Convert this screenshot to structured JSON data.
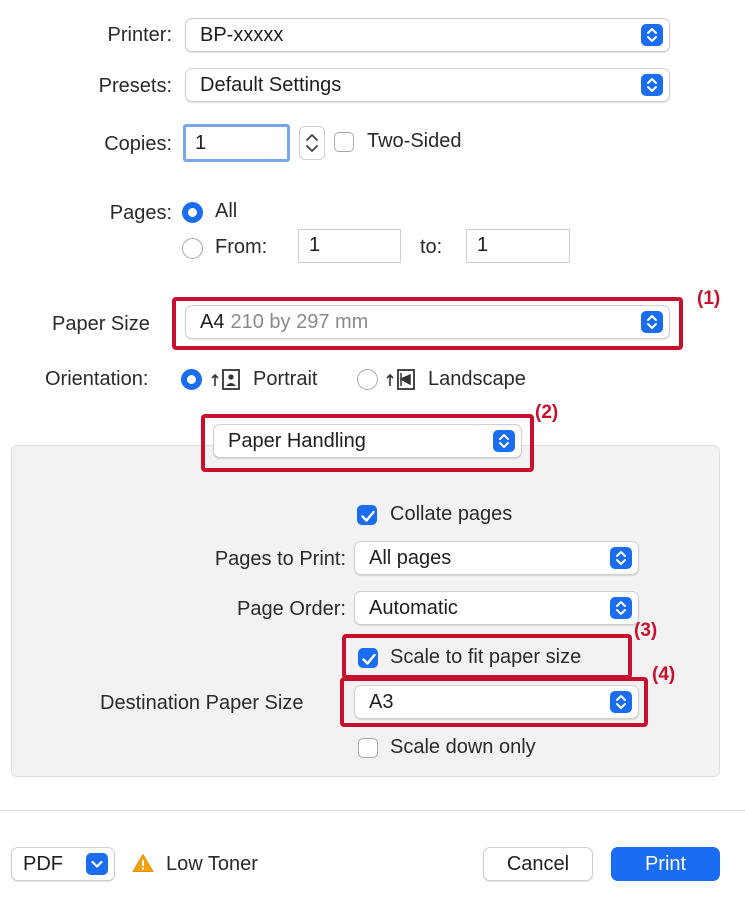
{
  "printer": {
    "label": "Printer:",
    "value": "BP-xxxxx"
  },
  "presets": {
    "label": "Presets:",
    "value": "Default Settings"
  },
  "copies": {
    "label": "Copies:",
    "value": "1",
    "two_sided_label": "Two-Sided",
    "two_sided_checked": false
  },
  "pages": {
    "label": "Pages:",
    "all_label": "All",
    "from_label": "From:",
    "from_value": "1",
    "to_label": "to:",
    "to_value": "1",
    "selected": "All"
  },
  "paper_size": {
    "label": "Paper Size",
    "value": "A4",
    "detail": "210 by 297 mm"
  },
  "orientation": {
    "label": "Orientation:",
    "portrait_label": "Portrait",
    "landscape_label": "Landscape",
    "selected": "Portrait"
  },
  "section_menu": {
    "value": "Paper Handling"
  },
  "paper_handling": {
    "collate_label": "Collate pages",
    "collate_checked": true,
    "pages_to_print_label": "Pages to Print:",
    "pages_to_print_value": "All pages",
    "page_order_label": "Page Order:",
    "page_order_value": "Automatic",
    "scale_fit_label": "Scale to fit paper size",
    "scale_fit_checked": true,
    "dest_size_label": "Destination Paper Size",
    "dest_size_value": "A3",
    "scale_down_label": "Scale down only",
    "scale_down_checked": false
  },
  "markers": {
    "m1": "(1)",
    "m2": "(2)",
    "m3": "(3)",
    "m4": "(4)"
  },
  "footer": {
    "pdf_label": "PDF",
    "warning_text": "Low Toner",
    "cancel_label": "Cancel",
    "print_label": "Print"
  },
  "colors": {
    "accent": "#1a6cf0",
    "highlight": "#c8102e",
    "warning": "#f2a20c"
  }
}
